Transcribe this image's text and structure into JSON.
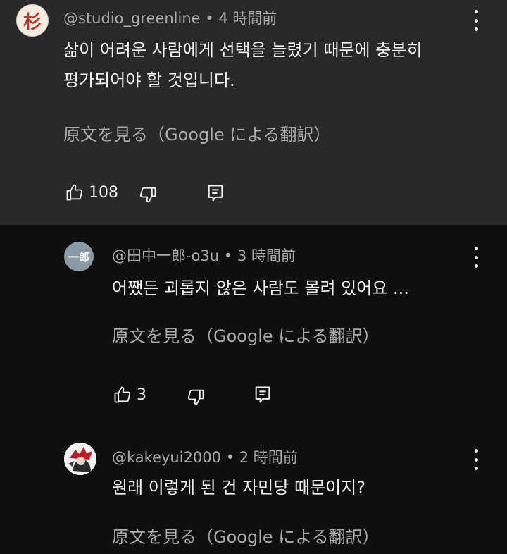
{
  "comments": [
    {
      "author": "@studio_greenline",
      "time": "4 時間前",
      "avatar_text": "杉",
      "text_lines": [
        "삶이 어려운 사람에게 선택을 늘렸기 때문에 충분히",
        "평가되어야 할 것입니다."
      ],
      "translate_label": "原文を見る（Google による翻訳）",
      "likes": "108"
    },
    {
      "author": "@田中一郎-o3u",
      "time": "3 時間前",
      "avatar_text": "一郎",
      "text_lines": [
        "어쨌든 괴롭지 않은 사람도 몰려 있어요 ..."
      ],
      "translate_label": "原文を見る（Google による翻訳）",
      "likes": "3"
    },
    {
      "author": "@kakeyui2000",
      "time": "2 時間前",
      "avatar_text": "",
      "text_lines": [
        "원래 이렇게 된 건 자민당 때문이지?"
      ],
      "translate_label": "原文を見る（Google による翻訳）"
    }
  ],
  "separator": " • ",
  "icons": {
    "like": "thumb-up-icon",
    "dislike": "thumb-down-icon",
    "reply": "reply-icon",
    "menu": "more-vert-icon"
  },
  "colors": {
    "highlight_bg": "#282828",
    "page_bg": "#0f0f0f",
    "secondary_text": "#aaaaaa",
    "primary_text": "#f1f1f1",
    "avatar2_bg": "#8a9aa6"
  }
}
